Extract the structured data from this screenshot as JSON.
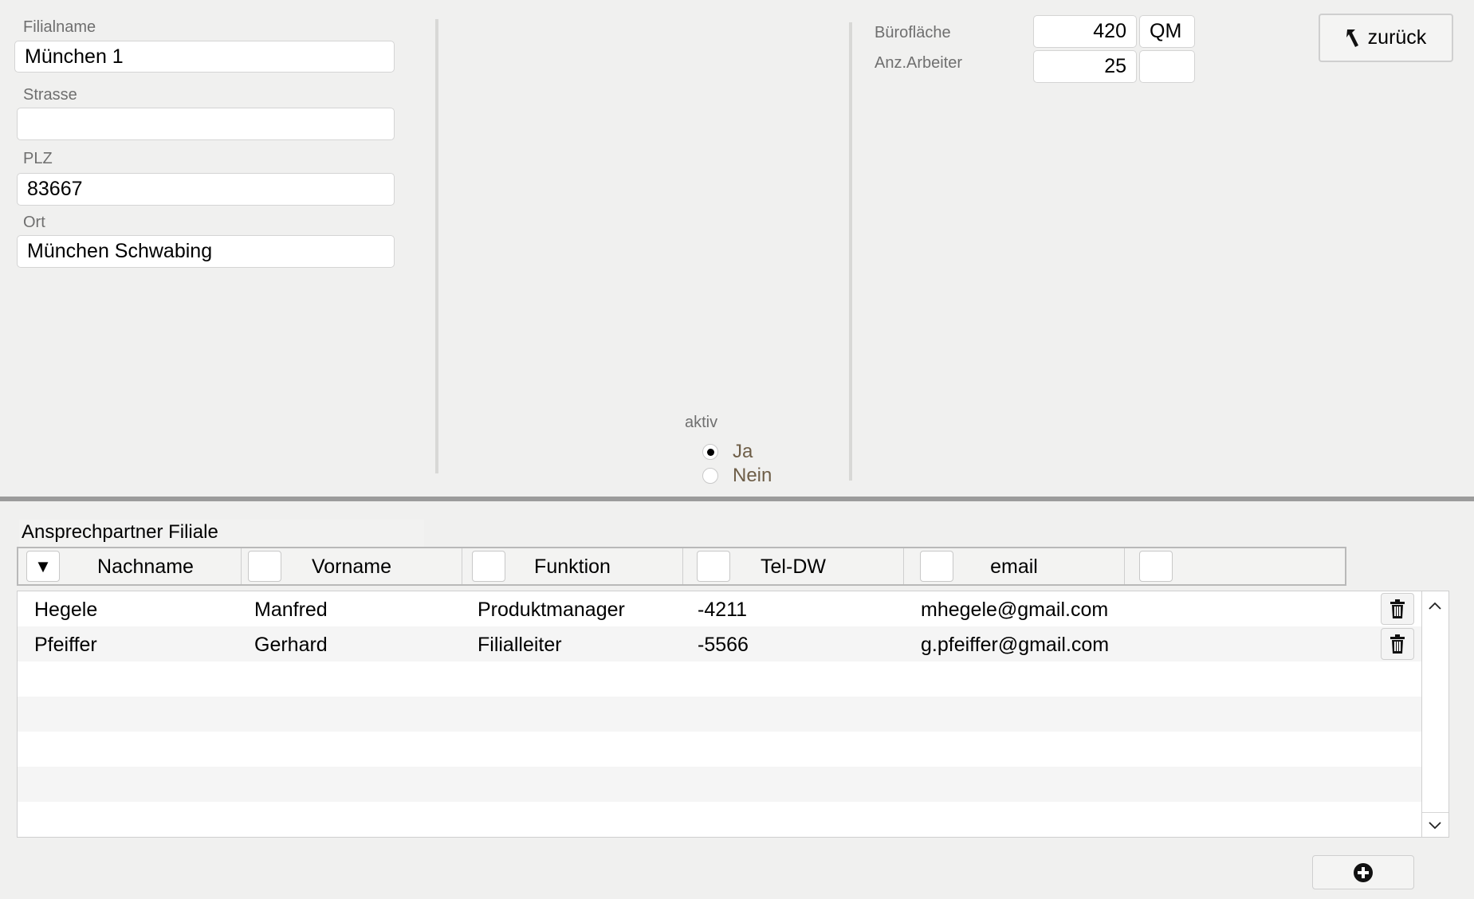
{
  "form": {
    "filialname": {
      "label": "Filialname",
      "value": "München 1"
    },
    "strasse": {
      "label": "Strasse",
      "value": ""
    },
    "plz": {
      "label": "PLZ",
      "value": "83667"
    },
    "ort": {
      "label": "Ort",
      "value": "München Schwabing"
    },
    "aktiv": {
      "label": "aktiv",
      "options": [
        "Ja",
        "Nein"
      ],
      "selected": "Ja"
    },
    "buroflache": {
      "label": "Bürofläche",
      "value": "420",
      "unit": "QM"
    },
    "arbeiter": {
      "label": "Anz.Arbeiter",
      "value": "25",
      "unit": ""
    }
  },
  "buttons": {
    "back_label": "zurück"
  },
  "contacts": {
    "title": "Ansprechpartner Filiale",
    "columns": [
      "Nachname",
      "Vorname",
      "Funktion",
      "Tel-DW",
      "email"
    ],
    "sort_indicator": "▼",
    "rows": [
      {
        "nachname": "Hegele",
        "vorname": "Manfred",
        "funktion": "Produktmanager",
        "tel": "-4211",
        "email": "mhegele@gmail.com"
      },
      {
        "nachname": "Pfeiffer",
        "vorname": "Gerhard",
        "funktion": "Filialleiter",
        "tel": "-5566",
        "email": "g.pfeiffer@gmail.com"
      }
    ]
  },
  "icons": {
    "back": "back-arrow-icon",
    "delete": "trash-icon",
    "add": "plus-circle-icon",
    "scroll_up": "chevron-up-icon",
    "scroll_down": "chevron-down-icon"
  }
}
